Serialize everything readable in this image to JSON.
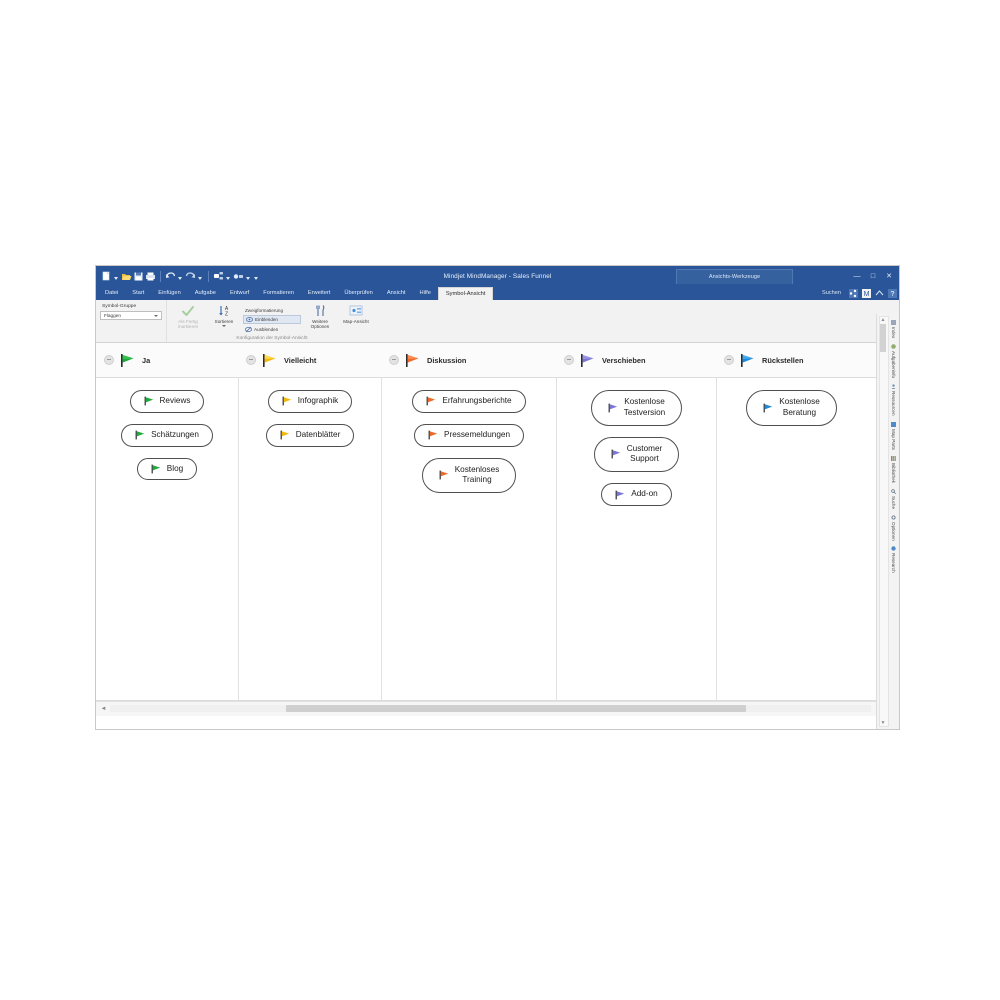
{
  "window": {
    "title": "Mindjet MindManager - Sales Funnel",
    "contextual_tab_group": "Ansichts-Werkzeuge",
    "minimize_label": "—",
    "maximize_label": "□",
    "close_label": "✕"
  },
  "quick_access": [
    {
      "icon": "new-document-icon",
      "label": "Neu"
    },
    {
      "icon": "open-folder-icon",
      "label": "Öffnen"
    },
    {
      "icon": "save-icon",
      "label": "Speichern"
    },
    {
      "icon": "print-icon",
      "label": "Drucken"
    },
    {
      "icon": "undo-icon",
      "label": "Rückgängig"
    },
    {
      "icon": "redo-icon",
      "label": "Wiederholen"
    },
    {
      "icon": "new-topic-icon",
      "label": "Neues Thema"
    },
    {
      "icon": "subtopic-icon",
      "label": "Unterthema"
    }
  ],
  "ribbon": {
    "tabs": [
      {
        "label": "Datei",
        "active": false
      },
      {
        "label": "Start",
        "active": false
      },
      {
        "label": "Einfügen",
        "active": false
      },
      {
        "label": "Aufgabe",
        "active": false
      },
      {
        "label": "Entwurf",
        "active": false
      },
      {
        "label": "Formatieren",
        "active": false
      },
      {
        "label": "Erweitert",
        "active": false
      },
      {
        "label": "Überprüfen",
        "active": false
      },
      {
        "label": "Ansicht",
        "active": false
      },
      {
        "label": "Hilfe",
        "active": false
      },
      {
        "label": "Symbol-Ansicht",
        "active": true
      }
    ],
    "search_placeholder": "Suchen",
    "group_label": "Konfiguration der Symbol-Ansicht",
    "symbol_group": {
      "label": "Symbol-Gruppe",
      "dropdown_value": "Flaggen"
    },
    "commands": [
      {
        "label": "Als Fertig markieren",
        "icon": "checkmark-icon",
        "disabled": true
      },
      {
        "label": "Sortieren",
        "icon": "sort-az-icon",
        "disabled": false,
        "has_dropdown": true
      },
      {
        "label": "Weitere Optionen",
        "icon": "options-icon",
        "disabled": false
      },
      {
        "label": "Map-Ansicht",
        "icon": "map-view-icon",
        "disabled": false
      }
    ],
    "branch_formatting": {
      "label": "Zweigformatierung",
      "show_label": "Einblenden",
      "hide_label": "Ausblenden",
      "show_icon": "show-icon",
      "hide_icon": "hide-icon",
      "show_selected": true
    }
  },
  "columns": [
    {
      "name": "Ja",
      "flag_color": "#1faa3c",
      "flag_icon": "flag-green-icon",
      "cards": [
        {
          "text": "Reviews",
          "flag_color": "#1faa3c"
        },
        {
          "text": "Schätzungen",
          "flag_color": "#1faa3c"
        },
        {
          "text": "Blog",
          "flag_color": "#1faa3c"
        }
      ]
    },
    {
      "name": "Vielleicht",
      "flag_color": "#f2b90c",
      "flag_icon": "flag-yellow-icon",
      "cards": [
        {
          "text": "Infographik",
          "flag_color": "#f2b90c"
        },
        {
          "text": "Datenblätter",
          "flag_color": "#f2b90c"
        }
      ]
    },
    {
      "name": "Diskussion",
      "flag_color": "#ee6a2b",
      "flag_icon": "flag-orange-icon",
      "cards": [
        {
          "text": "Erfahrungsberichte",
          "flag_color": "#ee6a2b"
        },
        {
          "text": "Pressemeldungen",
          "flag_color": "#ee6a2b"
        },
        {
          "text": "Kostenloses\nTraining",
          "flag_color": "#ee6a2b"
        }
      ]
    },
    {
      "name": "Verschieben",
      "flag_color": "#7b76d6",
      "flag_icon": "flag-purple-icon",
      "cards": [
        {
          "text": "Kostenlose\nTestversion",
          "flag_color": "#7b76d6"
        },
        {
          "text": "Customer\nSupport",
          "flag_color": "#7b76d6"
        },
        {
          "text": "Add-on",
          "flag_color": "#7b76d6"
        }
      ]
    },
    {
      "name": "Rückstellen",
      "flag_color": "#1b8bdd",
      "flag_icon": "flag-blue-icon",
      "cards": [
        {
          "text": "Kostenlose\nBeratung",
          "flag_color": "#1b8bdd"
        }
      ]
    }
  ],
  "task_pane_rail": [
    {
      "label": "Index",
      "icon": "index-icon"
    },
    {
      "label": "Aufgabeninfo",
      "icon": "task-info-icon"
    },
    {
      "label": "Ressourcen",
      "icon": "resources-icon"
    },
    {
      "label": "Map Parts",
      "icon": "map-parts-icon"
    },
    {
      "label": "Bibliothek",
      "icon": "library-icon"
    },
    {
      "label": "Suche",
      "icon": "search-icon"
    },
    {
      "label": "Optionen",
      "icon": "options-pane-icon"
    },
    {
      "label": "Research",
      "icon": "research-icon"
    }
  ],
  "scrollbars": {
    "h_left_arrow": "◄",
    "h_right_arrow": "►",
    "v_up_arrow": "▲",
    "v_down_arrow": "▼"
  }
}
